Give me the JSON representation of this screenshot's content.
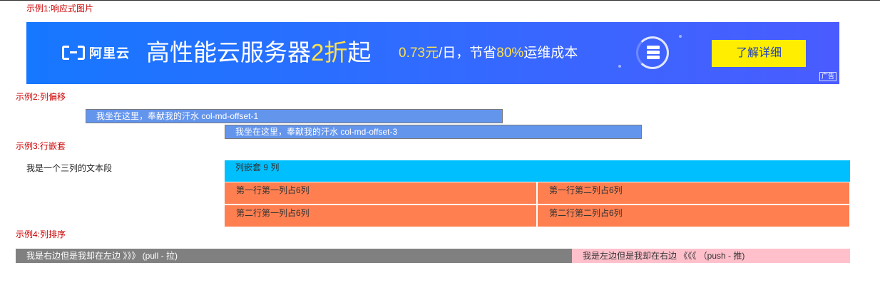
{
  "examples": {
    "ex1_title": "示例1:响应式图片",
    "ex2_title": "示例2:列偏移",
    "ex3_title": "示例3:行嵌套",
    "ex4_title": "示例4:列排序"
  },
  "banner": {
    "logo_text": "阿里云",
    "headline_part1": "高性能云服务器",
    "headline_highlight": "2折",
    "headline_part2": "起",
    "sub_price": "0.73元",
    "sub_part1": "/日，节省",
    "sub_highlight": "80%",
    "sub_part2": "运维成本",
    "cta_label": "了解详细",
    "ad_tag": "广告",
    "icon": "server-icon",
    "bg_color": "#1677ff",
    "cta_color": "#ffee00"
  },
  "offset": {
    "row1": "我坐在这里，奉献我的汗水 col-md-offset-1",
    "row2": "我坐在这里，奉献我的汗水 col-md-offset-3",
    "color": "#6495ed"
  },
  "nesting": {
    "three_col_text": "我是一个三列的文本段",
    "nest_header": "列嵌套 9 列",
    "cells": [
      "第一行第一列占6列",
      "第一行第二列占6列",
      "第二行第一列占6列",
      "第二行第二列占6列"
    ],
    "header_color": "#00bfff",
    "cell_color": "#ff7f50"
  },
  "ordering": {
    "pull_text": "我是右边但是我却在左边 》》》 (pull - 拉)",
    "push_text": "我是左边但是我却在右边 《《《 （push - 推)",
    "pull_color": "#808080",
    "push_color": "#ffc0cb"
  }
}
